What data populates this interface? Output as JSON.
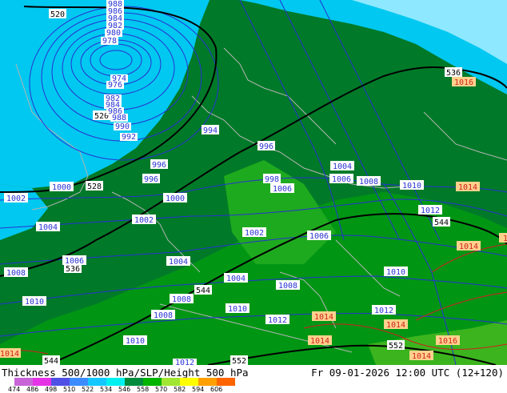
{
  "title": "Thickness 500/1000 hPa/SLP/Height 500 hPa",
  "valid_time": "Fr 09-01-2026 12:00 UTC (12+120)",
  "legend": {
    "ticks": [
      "474",
      "486",
      "498",
      "510",
      "522",
      "534",
      "546",
      "558",
      "570",
      "582",
      "594",
      "606"
    ],
    "colors": [
      "#c864d8",
      "#e632e6",
      "#5050e6",
      "#3c8cff",
      "#14c8ff",
      "#00f0f0",
      "#008c3c",
      "#00b400",
      "#a0e632",
      "#ffff00",
      "#ffa000",
      "#ff6400"
    ]
  },
  "colors": {
    "thickness_528_534": "#00c8f0",
    "thickness_534_546": "#007a28",
    "thickness_546_552": "#009614",
    "thickness_552_558": "#1eaa1e",
    "slp_isobar": "#2832d2",
    "height_500": "#000000",
    "high_pressure": "#d02020",
    "coast_border": "#b4b4b4"
  },
  "labels": {
    "height": [
      {
        "text": "520"
      },
      {
        "text": "528"
      },
      {
        "text": "536"
      },
      {
        "text": "536"
      },
      {
        "text": "544"
      },
      {
        "text": "544"
      },
      {
        "text": "544"
      },
      {
        "text": "552"
      },
      {
        "text": "552"
      },
      {
        "text": "520"
      }
    ],
    "slp_low": [
      {
        "text": "988"
      },
      {
        "text": "986"
      },
      {
        "text": "984"
      },
      {
        "text": "982"
      },
      {
        "text": "980"
      },
      {
        "text": "978"
      },
      {
        "text": "974"
      },
      {
        "text": "976"
      },
      {
        "text": "982"
      },
      {
        "text": "984"
      },
      {
        "text": "986"
      },
      {
        "text": "988"
      },
      {
        "text": "990"
      },
      {
        "text": "992"
      },
      {
        "text": "994"
      },
      {
        "text": "996"
      },
      {
        "text": "996"
      },
      {
        "text": "996"
      },
      {
        "text": "998"
      },
      {
        "text": "1000"
      },
      {
        "text": "1000"
      },
      {
        "text": "1002"
      },
      {
        "text": "1002"
      },
      {
        "text": "1002"
      },
      {
        "text": "1004"
      },
      {
        "text": "1004"
      },
      {
        "text": "1004"
      },
      {
        "text": "1006"
      },
      {
        "text": "1006"
      },
      {
        "text": "1006"
      },
      {
        "text": "1006"
      },
      {
        "text": "1008"
      },
      {
        "text": "1008"
      },
      {
        "text": "1008"
      },
      {
        "text": "1008"
      },
      {
        "text": "1008"
      },
      {
        "text": "1010"
      },
      {
        "text": "1010"
      },
      {
        "text": "1010"
      },
      {
        "text": "1010"
      },
      {
        "text": "1010"
      },
      {
        "text": "1012"
      },
      {
        "text": "1012"
      },
      {
        "text": "1012"
      },
      {
        "text": "1012"
      },
      {
        "text": "1004"
      },
      {
        "text": "1006"
      }
    ],
    "slp_high": [
      {
        "text": "1016"
      },
      {
        "text": "1014"
      },
      {
        "text": "1014"
      },
      {
        "text": "1014"
      },
      {
        "text": "1014"
      },
      {
        "text": "1014"
      },
      {
        "text": "1014"
      },
      {
        "text": "1016"
      },
      {
        "text": "1014"
      },
      {
        "text": "1014"
      },
      {
        "text": "101"
      }
    ]
  }
}
